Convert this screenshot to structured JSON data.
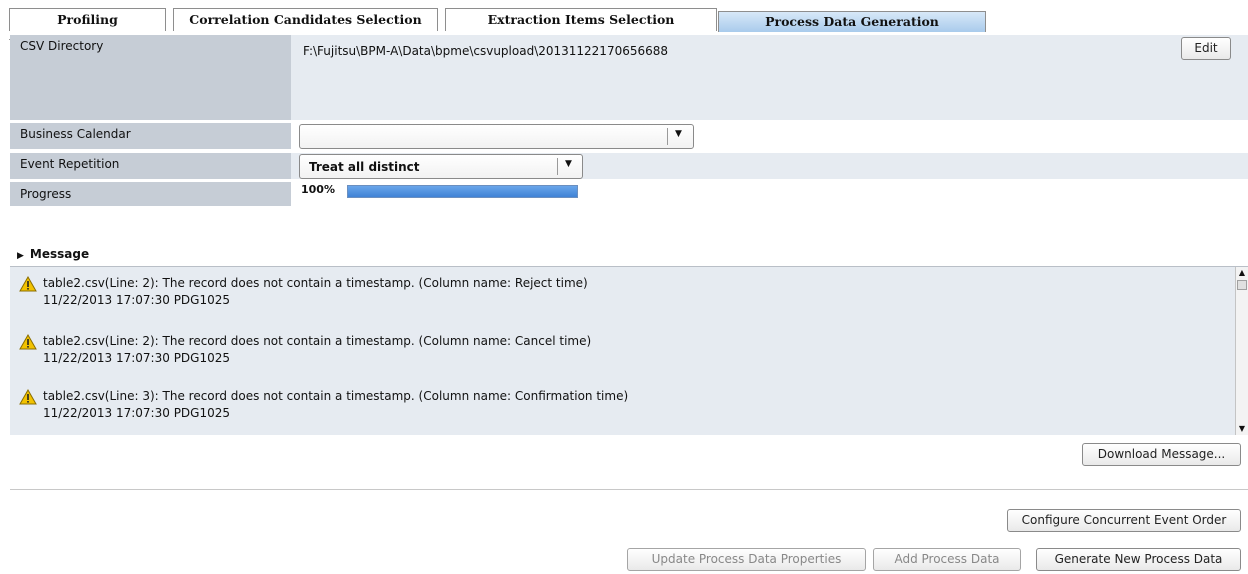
{
  "tabs": [
    {
      "label": "Profiling"
    },
    {
      "label": "Correlation Candidates Selection"
    },
    {
      "label": "Extraction Items Selection"
    },
    {
      "label": "Process Data Generation"
    }
  ],
  "active_tab": "Process Data Generation",
  "form": {
    "csv_directory": {
      "label": "CSV Directory",
      "value": "F:\\Fujitsu\\BPM-A\\Data\\bpme\\csvupload\\20131122170656688",
      "edit_label": "Edit"
    },
    "business_calendar": {
      "label": "Business Calendar",
      "value": ""
    },
    "event_repetition": {
      "label": "Event Repetition",
      "value": "Treat all distinct"
    },
    "progress": {
      "label": "Progress",
      "value_text": "100%",
      "value": 1.0
    }
  },
  "message": {
    "header": "Message",
    "items": [
      {
        "text": "table2.csv(Line: 2): The record does not contain a timestamp. (Column name: Reject time)",
        "meta": "11/22/2013 17:07:30 PDG1025"
      },
      {
        "text": "table2.csv(Line: 2): The record does not contain a timestamp. (Column name: Cancel time)",
        "meta": "11/22/2013 17:07:30 PDG1025"
      },
      {
        "text": "table2.csv(Line: 3): The record does not contain a timestamp. (Column name: Confirmation time)",
        "meta": "11/22/2013 17:07:30 PDG1025"
      }
    ],
    "download_label": "Download Message..."
  },
  "actions": {
    "configure_label": "Configure Concurrent Event Order",
    "update_label": "Update Process Data Properties",
    "add_label": "Add Process Data",
    "generate_label": "Generate New Process Data"
  },
  "colors": {
    "accent": "#4a8fe0",
    "warning": "#f2c200"
  }
}
